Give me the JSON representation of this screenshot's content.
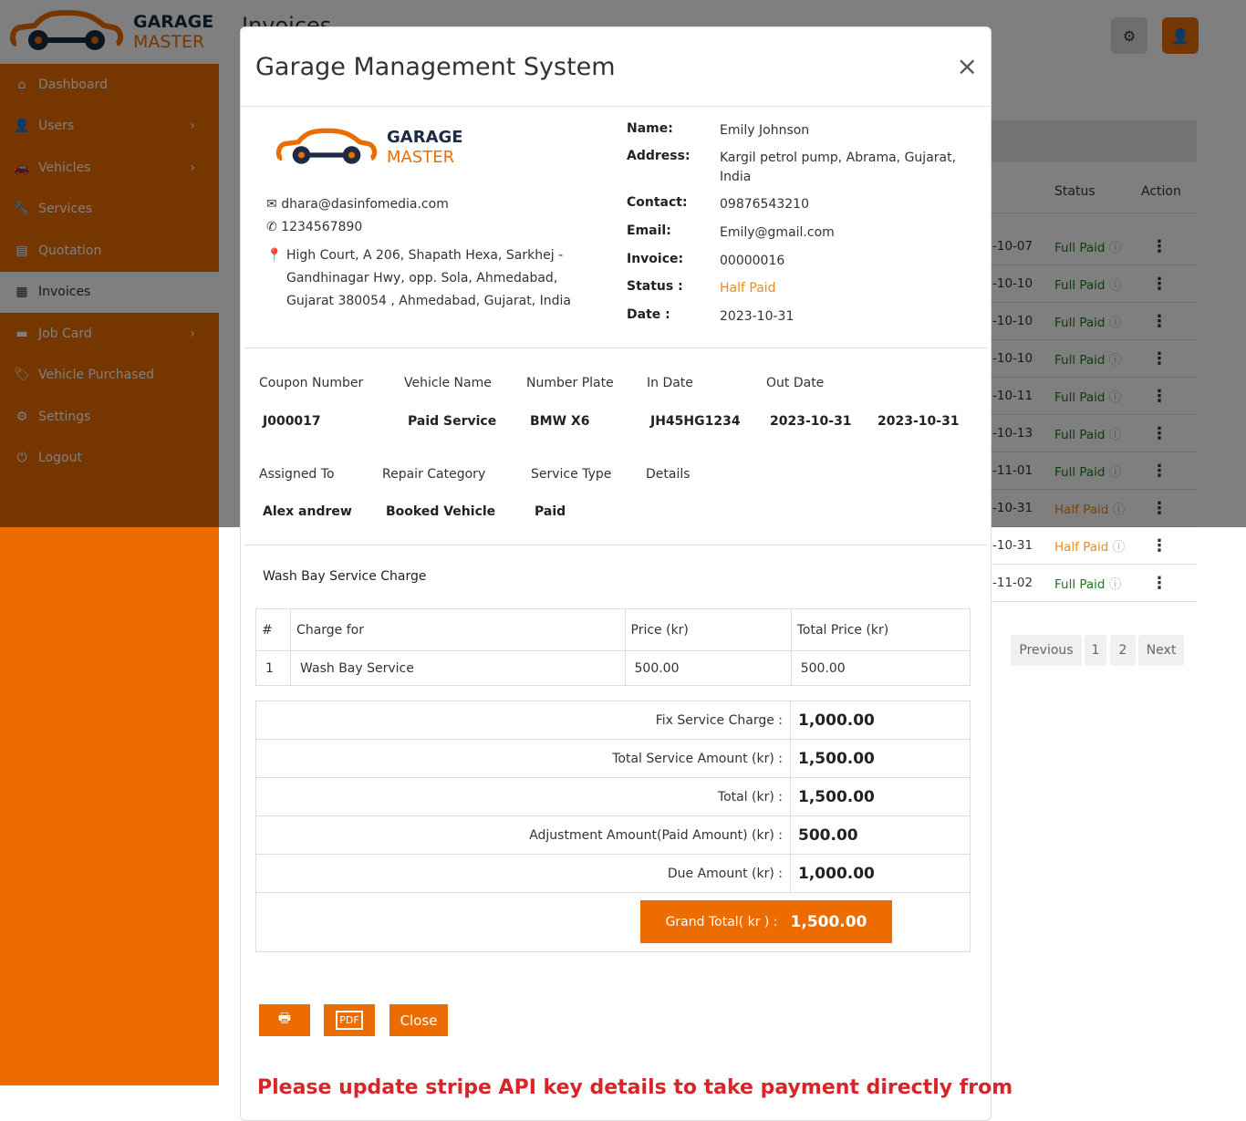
{
  "brand": {
    "line1": "GARAGE",
    "line2": "MASTER",
    "accent": "#ec6c00",
    "dark": "#1d2b44"
  },
  "sidebar": {
    "items": [
      {
        "label": "Dashboard",
        "icon": "home-icon",
        "chev": false
      },
      {
        "label": "Users",
        "icon": "user-icon",
        "chev": true
      },
      {
        "label": "Vehicles",
        "icon": "car-icon",
        "chev": true
      },
      {
        "label": "Services",
        "icon": "wrench-icon",
        "chev": false
      },
      {
        "label": "Quotation",
        "icon": "document-icon",
        "chev": false
      },
      {
        "label": "Invoices",
        "icon": "invoice-icon",
        "chev": false,
        "active": true
      },
      {
        "label": "Job Card",
        "icon": "card-icon",
        "chev": true
      },
      {
        "label": "Vehicle Purchased",
        "icon": "tag-icon",
        "chev": false
      },
      {
        "label": "Settings",
        "icon": "gear-icon",
        "chev": false
      },
      {
        "label": "Logout",
        "icon": "power-icon",
        "chev": false
      }
    ]
  },
  "page": {
    "title": "Invoices"
  },
  "list": {
    "headers": {
      "status": "Status",
      "action": "Action"
    },
    "rows": [
      {
        "date": "-10-07",
        "status": "Full Paid"
      },
      {
        "date": "-10-10",
        "status": "Full Paid"
      },
      {
        "date": "-10-10",
        "status": "Full Paid"
      },
      {
        "date": "-10-10",
        "status": "Full Paid"
      },
      {
        "date": "-10-11",
        "status": "Full Paid"
      },
      {
        "date": "-10-13",
        "status": "Full Paid"
      },
      {
        "date": "-11-01",
        "status": "Full Paid"
      },
      {
        "date": "-10-31",
        "status": "Half Paid"
      },
      {
        "date": "-10-31",
        "status": "Half Paid"
      },
      {
        "date": "-11-02",
        "status": "Full Paid"
      }
    ]
  },
  "pagination": {
    "previous": "Previous",
    "pages": [
      "1",
      "2"
    ],
    "next": "Next"
  },
  "modal": {
    "title": "Garage Management System",
    "company": {
      "email": "dhara@dasinfomedia.com",
      "phone": "1234567890",
      "address": "High Court, A 206, Shapath Hexa, Sarkhej - Gandhinagar Hwy, opp. Sola, Ahmedabad, Gujarat 380054 , Ahmedabad, Gujarat, India"
    },
    "customer": [
      {
        "label": "Name:",
        "value": "Emily Johnson"
      },
      {
        "label": "Address:",
        "value": "Kargil petrol pump, Abrama, Gujarat, India"
      },
      {
        "label": "Contact:",
        "value": "09876543210"
      },
      {
        "label": "Email:",
        "value": "Emily@gmail.com"
      },
      {
        "label": "Invoice:",
        "value": "00000016"
      },
      {
        "label": "Status :",
        "value": "Half Paid"
      },
      {
        "label": "Date :",
        "value": "2023-10-31"
      }
    ],
    "details1": {
      "headers": [
        "Coupon Number",
        "Vehicle Name",
        "Number Plate",
        "In Date",
        "Out Date"
      ],
      "values": [
        "J000017",
        "Paid Service",
        "BMW X6",
        "JH45HG1234",
        "2023-10-31",
        "2023-10-31"
      ]
    },
    "details2": {
      "headers": [
        "Assigned To",
        "Repair Category",
        "Service Type",
        "Details"
      ],
      "values": [
        "Alex andrew",
        "Booked Vehicle",
        "Paid"
      ]
    },
    "section_title": "Wash Bay Service Charge",
    "charges": {
      "headers": [
        "#",
        "Charge for",
        "Price (kr)",
        "Total Price (kr)"
      ],
      "rows": [
        [
          "1",
          "Wash Bay Service",
          "500.00",
          "500.00"
        ]
      ]
    },
    "totals": [
      {
        "label": "Fix Service Charge :",
        "value": "1,000.00"
      },
      {
        "label": "Total Service Amount (kr) :",
        "value": "1,500.00"
      },
      {
        "label": "Total (kr) :",
        "value": "1,500.00"
      },
      {
        "label": "Adjustment Amount(Paid Amount) (kr) :",
        "value": "500.00"
      },
      {
        "label": "Due Amount (kr) :",
        "value": "1,000.00"
      }
    ],
    "grand_total": {
      "label": "Grand Total( kr ) :",
      "value": "1,500.00"
    },
    "buttons": {
      "close": "Close"
    },
    "warning": "Please update stripe API key details to take payment directly from"
  }
}
